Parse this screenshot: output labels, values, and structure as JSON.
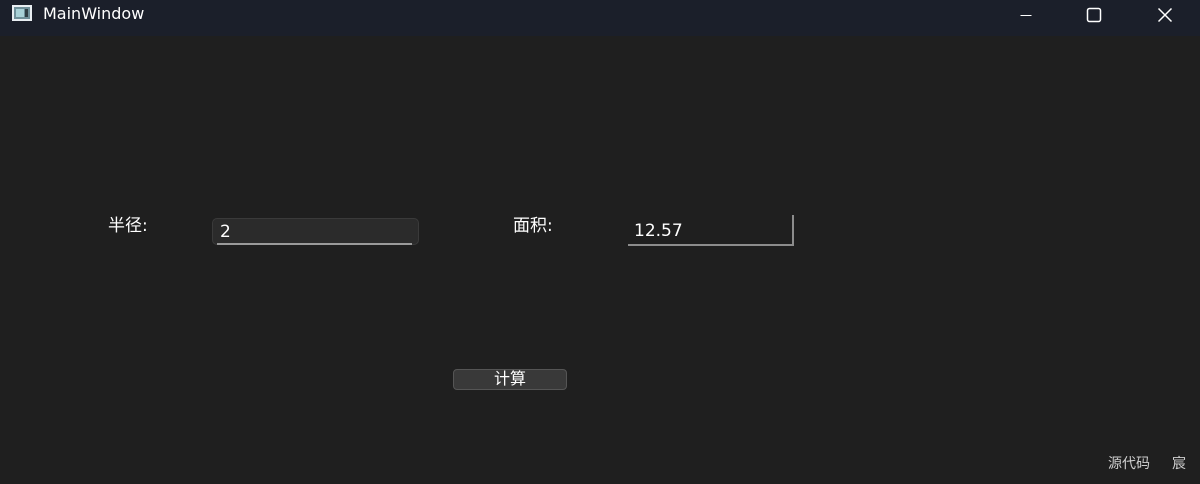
{
  "window": {
    "title": "MainWindow",
    "controls": [
      "minimize-icon",
      "maximize-icon",
      "close-icon"
    ]
  },
  "form": {
    "radius_label": "半径:",
    "radius_value": "2",
    "area_label": "面积:",
    "area_value": "12.57",
    "calculate_label": "计算"
  },
  "overlay": {
    "source_code": "源代码",
    "extra": "宸"
  },
  "colors": {
    "titlebar_bg": "#1b1f2a",
    "window_bg": "#1f1f1f",
    "input_bg": "#2b2b2b",
    "button_bg": "#393939",
    "text": "#ffffff"
  }
}
